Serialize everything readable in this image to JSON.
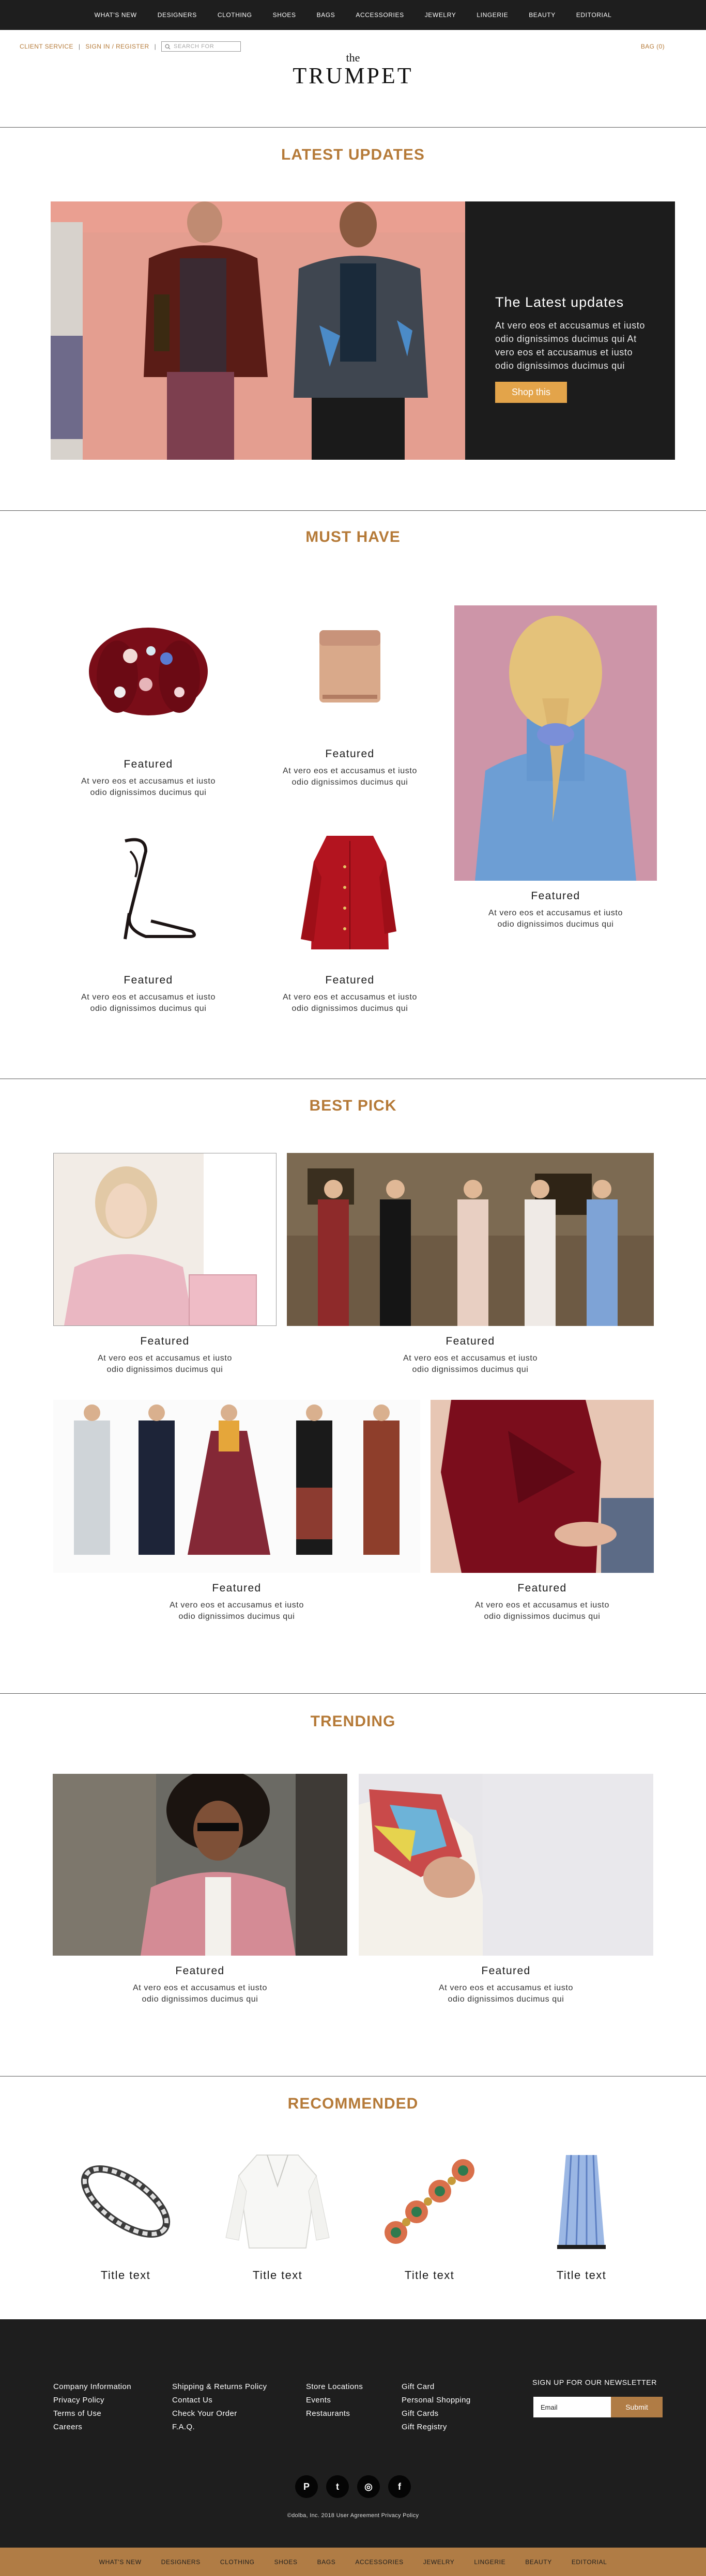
{
  "nav": {
    "items": [
      "WHAT'S NEW",
      "DESIGNERS",
      "CLOTHING",
      "SHOES",
      "BAGS",
      "ACCESSORIES",
      "JEWELRY",
      "LINGERIE",
      "BEAUTY",
      "EDITORIAL"
    ]
  },
  "utility": {
    "client_service": "CLIENT SERVICE",
    "sign_in": "SIGN IN / REGISTER",
    "search_placeholder": "SEARCH FOR",
    "bag": "BAG (0)"
  },
  "logo": {
    "the": "the",
    "name": "TRUMPET"
  },
  "latest": {
    "title": "LATEST UPDATES",
    "heading": "The Latest updates",
    "text": "At vero eos et accusamus et iusto odio dignissimos ducimus qui At vero eos et accusamus et iusto odio dignissimos ducimus qui",
    "button": "Shop this"
  },
  "must_have": {
    "title": "MUST HAVE",
    "items": [
      {
        "title": "Featured",
        "desc": "At vero eos et accusamus et iusto odio dignissimos ducimus qui"
      },
      {
        "title": "Featured",
        "desc": "At vero eos et accusamus et iusto odio dignissimos ducimus qui"
      },
      {
        "title": "Featured",
        "desc": "At vero eos et accusamus et iusto odio dignissimos ducimus qui"
      },
      {
        "title": "Featured",
        "desc": "At vero eos et accusamus et iusto odio dignissimos ducimus qui"
      },
      {
        "title": "Featured",
        "desc": "At vero eos et accusamus et iusto odio dignissimos ducimus qui"
      }
    ]
  },
  "best_pick": {
    "title": "BEST PICK",
    "items": [
      {
        "title": "Featured",
        "desc": "At vero eos et accusamus et iusto odio dignissimos ducimus qui"
      },
      {
        "title": "Featured",
        "desc": "At vero eos et accusamus et iusto odio dignissimos ducimus qui"
      },
      {
        "title": "Featured",
        "desc": "At vero eos et accusamus et iusto odio dignissimos ducimus qui"
      },
      {
        "title": "Featured",
        "desc": "At vero eos et accusamus et iusto odio dignissimos ducimus qui"
      }
    ]
  },
  "trending": {
    "title": "TRENDING",
    "items": [
      {
        "title": "Featured",
        "desc": "At vero eos et accusamus et iusto odio dignissimos ducimus qui"
      },
      {
        "title": "Featured",
        "desc": "At vero eos et accusamus et iusto odio dignissimos ducimus qui"
      }
    ]
  },
  "recommended": {
    "title": "RECOMMENDED",
    "items": [
      {
        "title": "Title text"
      },
      {
        "title": "Title text"
      },
      {
        "title": "Title text"
      },
      {
        "title": "Title text"
      }
    ]
  },
  "footer": {
    "col1": [
      "Company Information",
      "Privacy Policy",
      "Terms of Use",
      "Careers"
    ],
    "col2": [
      "Shipping & Returns Policy",
      "Contact Us",
      "Check Your Order",
      "F.A.Q."
    ],
    "col3": [
      "Store Locations",
      "Events",
      "Restaurants"
    ],
    "col4": [
      "Gift Card",
      "Personal Shopping",
      "Gift Cards",
      "Gift Registry"
    ],
    "newsletter_label": "SIGN UP FOR OUR NEWSLETTER",
    "email_placeholder": "Email",
    "submit": "Submit",
    "social": [
      "P",
      "t",
      "◎",
      "f"
    ],
    "copyright": "©dolba, Inc. 2018 User Agreement Privacy Policy"
  },
  "colors": {
    "accent": "#b57a38",
    "dark": "#1e1e1e",
    "button": "#e3a44a",
    "footer_bar": "#b07c45"
  }
}
